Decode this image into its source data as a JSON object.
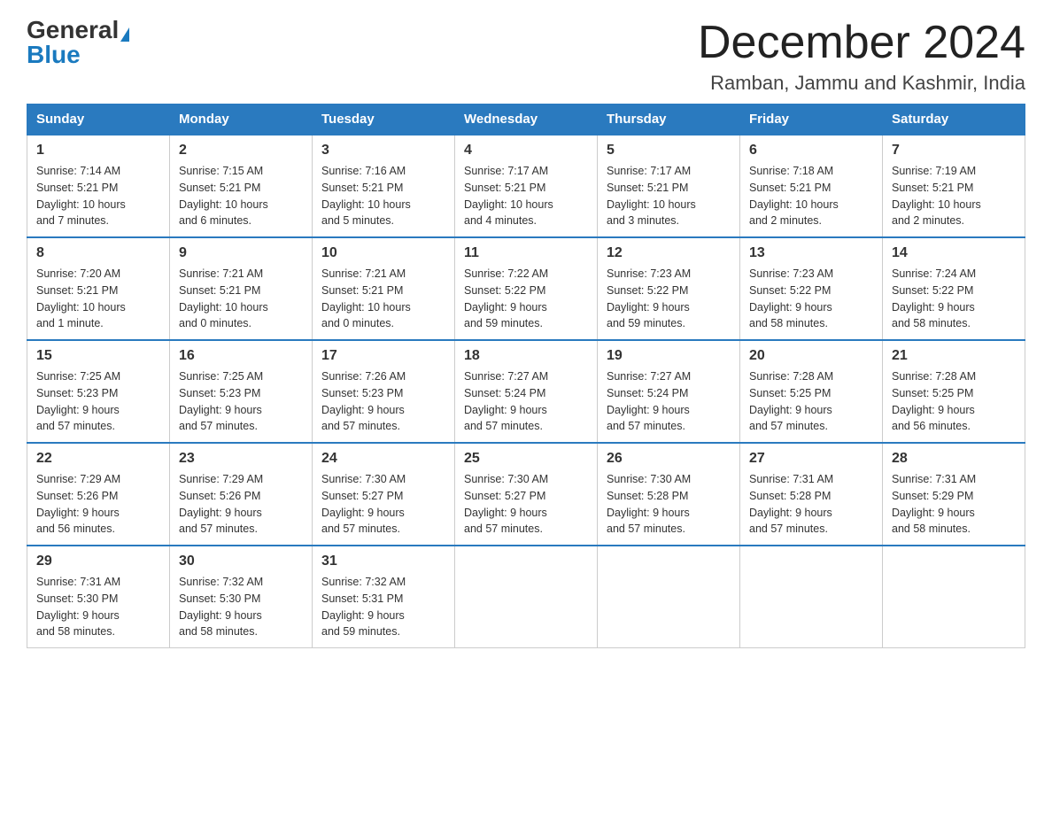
{
  "header": {
    "logo_general": "General",
    "logo_blue": "Blue",
    "month_title": "December 2024",
    "location": "Ramban, Jammu and Kashmir, India"
  },
  "weekdays": [
    "Sunday",
    "Monday",
    "Tuesday",
    "Wednesday",
    "Thursday",
    "Friday",
    "Saturday"
  ],
  "weeks": [
    [
      {
        "day": "1",
        "sunrise": "7:14 AM",
        "sunset": "5:21 PM",
        "daylight": "10 hours and 7 minutes."
      },
      {
        "day": "2",
        "sunrise": "7:15 AM",
        "sunset": "5:21 PM",
        "daylight": "10 hours and 6 minutes."
      },
      {
        "day": "3",
        "sunrise": "7:16 AM",
        "sunset": "5:21 PM",
        "daylight": "10 hours and 5 minutes."
      },
      {
        "day": "4",
        "sunrise": "7:17 AM",
        "sunset": "5:21 PM",
        "daylight": "10 hours and 4 minutes."
      },
      {
        "day": "5",
        "sunrise": "7:17 AM",
        "sunset": "5:21 PM",
        "daylight": "10 hours and 3 minutes."
      },
      {
        "day": "6",
        "sunrise": "7:18 AM",
        "sunset": "5:21 PM",
        "daylight": "10 hours and 2 minutes."
      },
      {
        "day": "7",
        "sunrise": "7:19 AM",
        "sunset": "5:21 PM",
        "daylight": "10 hours and 2 minutes."
      }
    ],
    [
      {
        "day": "8",
        "sunrise": "7:20 AM",
        "sunset": "5:21 PM",
        "daylight": "10 hours and 1 minute."
      },
      {
        "day": "9",
        "sunrise": "7:21 AM",
        "sunset": "5:21 PM",
        "daylight": "10 hours and 0 minutes."
      },
      {
        "day": "10",
        "sunrise": "7:21 AM",
        "sunset": "5:21 PM",
        "daylight": "10 hours and 0 minutes."
      },
      {
        "day": "11",
        "sunrise": "7:22 AM",
        "sunset": "5:22 PM",
        "daylight": "9 hours and 59 minutes."
      },
      {
        "day": "12",
        "sunrise": "7:23 AM",
        "sunset": "5:22 PM",
        "daylight": "9 hours and 59 minutes."
      },
      {
        "day": "13",
        "sunrise": "7:23 AM",
        "sunset": "5:22 PM",
        "daylight": "9 hours and 58 minutes."
      },
      {
        "day": "14",
        "sunrise": "7:24 AM",
        "sunset": "5:22 PM",
        "daylight": "9 hours and 58 minutes."
      }
    ],
    [
      {
        "day": "15",
        "sunrise": "7:25 AM",
        "sunset": "5:23 PM",
        "daylight": "9 hours and 57 minutes."
      },
      {
        "day": "16",
        "sunrise": "7:25 AM",
        "sunset": "5:23 PM",
        "daylight": "9 hours and 57 minutes."
      },
      {
        "day": "17",
        "sunrise": "7:26 AM",
        "sunset": "5:23 PM",
        "daylight": "9 hours and 57 minutes."
      },
      {
        "day": "18",
        "sunrise": "7:27 AM",
        "sunset": "5:24 PM",
        "daylight": "9 hours and 57 minutes."
      },
      {
        "day": "19",
        "sunrise": "7:27 AM",
        "sunset": "5:24 PM",
        "daylight": "9 hours and 57 minutes."
      },
      {
        "day": "20",
        "sunrise": "7:28 AM",
        "sunset": "5:25 PM",
        "daylight": "9 hours and 57 minutes."
      },
      {
        "day": "21",
        "sunrise": "7:28 AM",
        "sunset": "5:25 PM",
        "daylight": "9 hours and 56 minutes."
      }
    ],
    [
      {
        "day": "22",
        "sunrise": "7:29 AM",
        "sunset": "5:26 PM",
        "daylight": "9 hours and 56 minutes."
      },
      {
        "day": "23",
        "sunrise": "7:29 AM",
        "sunset": "5:26 PM",
        "daylight": "9 hours and 57 minutes."
      },
      {
        "day": "24",
        "sunrise": "7:30 AM",
        "sunset": "5:27 PM",
        "daylight": "9 hours and 57 minutes."
      },
      {
        "day": "25",
        "sunrise": "7:30 AM",
        "sunset": "5:27 PM",
        "daylight": "9 hours and 57 minutes."
      },
      {
        "day": "26",
        "sunrise": "7:30 AM",
        "sunset": "5:28 PM",
        "daylight": "9 hours and 57 minutes."
      },
      {
        "day": "27",
        "sunrise": "7:31 AM",
        "sunset": "5:28 PM",
        "daylight": "9 hours and 57 minutes."
      },
      {
        "day": "28",
        "sunrise": "7:31 AM",
        "sunset": "5:29 PM",
        "daylight": "9 hours and 58 minutes."
      }
    ],
    [
      {
        "day": "29",
        "sunrise": "7:31 AM",
        "sunset": "5:30 PM",
        "daylight": "9 hours and 58 minutes."
      },
      {
        "day": "30",
        "sunrise": "7:32 AM",
        "sunset": "5:30 PM",
        "daylight": "9 hours and 58 minutes."
      },
      {
        "day": "31",
        "sunrise": "7:32 AM",
        "sunset": "5:31 PM",
        "daylight": "9 hours and 59 minutes."
      },
      null,
      null,
      null,
      null
    ]
  ],
  "labels": {
    "sunrise": "Sunrise:",
    "sunset": "Sunset:",
    "daylight": "Daylight:"
  }
}
